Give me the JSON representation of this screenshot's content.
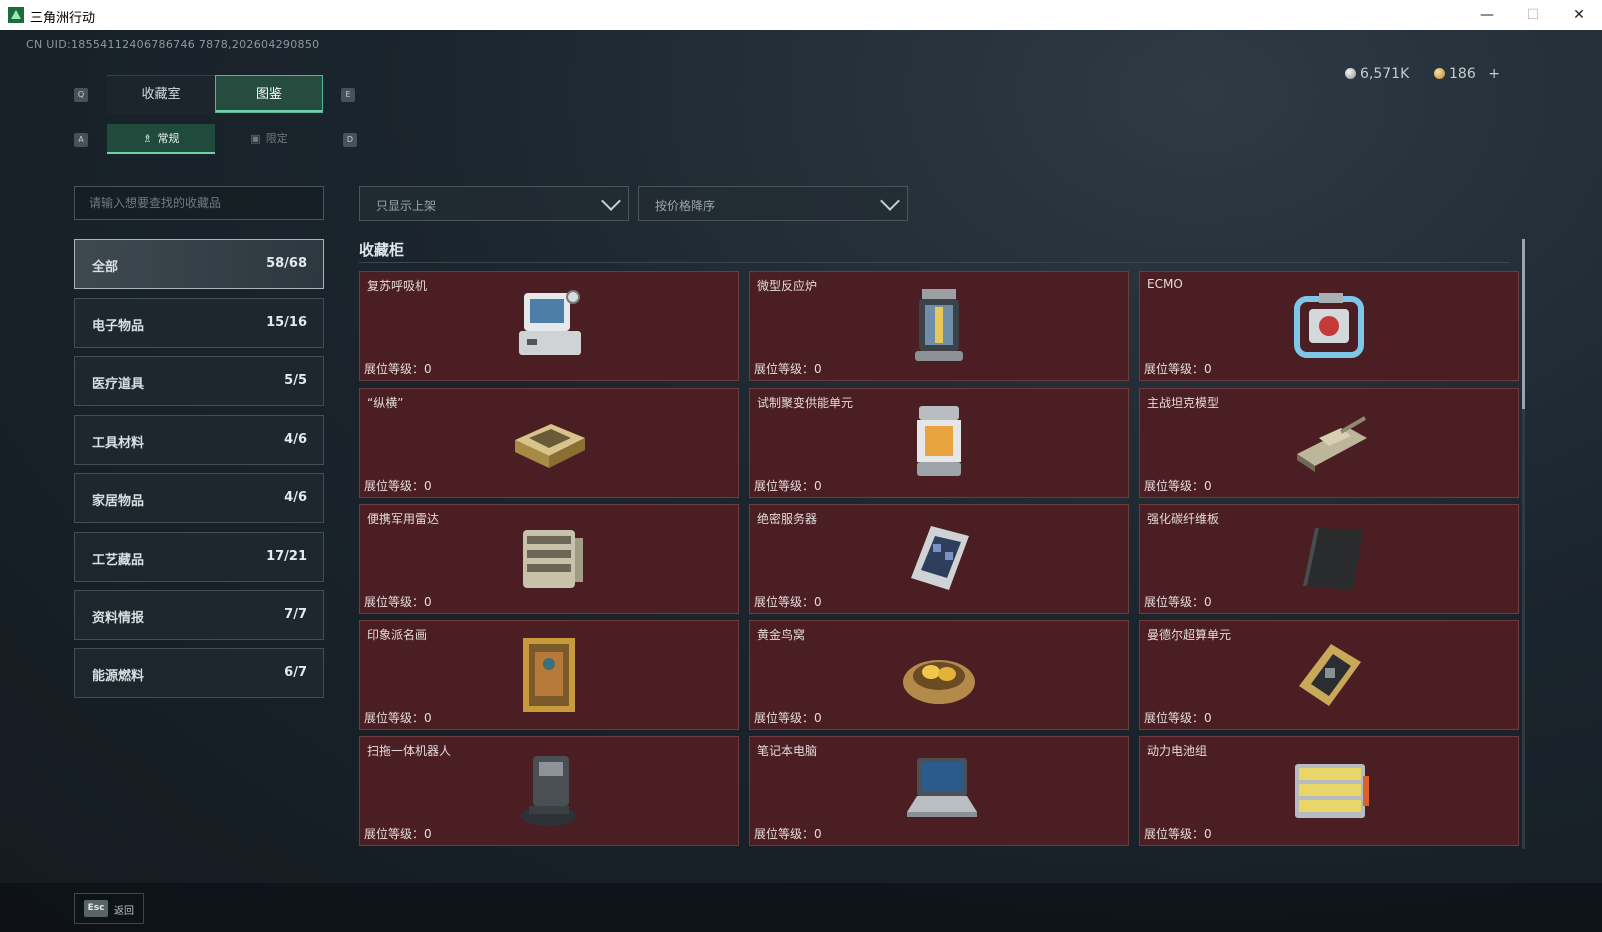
{
  "window": {
    "title": "三角洲行动",
    "minimize": "—",
    "maximize": "☐",
    "close": "✕"
  },
  "uid": "CN UID:18554112406786746 7878,202604290850",
  "currency": {
    "silver": "6,571K",
    "gold": "186",
    "plus": "+"
  },
  "tabs": {
    "prev_key": "Q",
    "next_key": "E",
    "items": [
      {
        "label": "收藏室"
      },
      {
        "label": "图鉴"
      }
    ]
  },
  "subtabs": {
    "prev_key": "A",
    "next_key": "D",
    "items": [
      {
        "label": "常规"
      },
      {
        "label": "限定"
      }
    ]
  },
  "search": {
    "placeholder": "请输入想要查找的收藏品"
  },
  "filters": {
    "availability": "只显示上架",
    "sort": "按价格降序"
  },
  "categories": [
    {
      "name": "全部",
      "count": "58/68"
    },
    {
      "name": "电子物品",
      "count": "15/16"
    },
    {
      "name": "医疗道具",
      "count": "5/5"
    },
    {
      "name": "工具材料",
      "count": "4/6"
    },
    {
      "name": "家居物品",
      "count": "4/6"
    },
    {
      "name": "工艺藏品",
      "count": "17/21"
    },
    {
      "name": "资料情报",
      "count": "7/7"
    },
    {
      "name": "能源燃料",
      "count": "6/7"
    }
  ],
  "section_title": "收藏柜",
  "level_label": "展位等级：",
  "items": [
    {
      "name": "复苏呼吸机",
      "level": "0",
      "icon": "ventilator-icon"
    },
    {
      "name": "微型反应炉",
      "level": "0",
      "icon": "reactor-icon"
    },
    {
      "name": "ECMO",
      "level": "0",
      "icon": "ecmo-icon"
    },
    {
      "name": "“纵横”",
      "level": "0",
      "icon": "chessboard-icon"
    },
    {
      "name": "试制聚变供能单元",
      "level": "0",
      "icon": "fusion-unit-icon"
    },
    {
      "name": "主战坦克模型",
      "level": "0",
      "icon": "tank-model-icon"
    },
    {
      "name": "便携军用雷达",
      "level": "0",
      "icon": "radar-icon"
    },
    {
      "name": "绝密服务器",
      "level": "0",
      "icon": "server-icon"
    },
    {
      "name": "强化碳纤维板",
      "level": "0",
      "icon": "carbon-plate-icon"
    },
    {
      "name": "印象派名画",
      "level": "0",
      "icon": "painting-icon"
    },
    {
      "name": "黄金鸟窝",
      "level": "0",
      "icon": "golden-nest-icon"
    },
    {
      "name": "曼德尔超算单元",
      "level": "0",
      "icon": "supercomputer-icon"
    },
    {
      "name": "扫拖一体机器人",
      "level": "0",
      "icon": "robot-vacuum-icon"
    },
    {
      "name": "笔记本电脑",
      "level": "0",
      "icon": "laptop-icon"
    },
    {
      "name": "动力电池组",
      "level": "0",
      "icon": "battery-pack-icon"
    }
  ],
  "footer": {
    "key": "Esc",
    "label": "返回"
  }
}
